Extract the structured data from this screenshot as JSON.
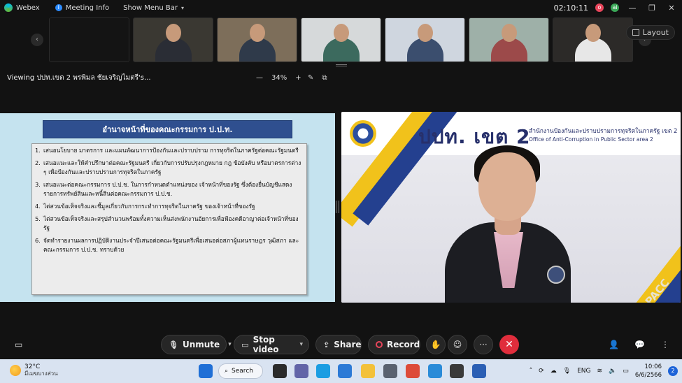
{
  "titlebar": {
    "app_name": "Webex",
    "meeting_info": "Meeting Info",
    "show_menu_bar": "Show Menu Bar",
    "timer": "02:10:11",
    "badge_o": "o",
    "badge_ai": "ai"
  },
  "strip": {
    "layout_label": "Layout",
    "thumbnails": [
      {
        "bg": "#141414",
        "shirt": "#1a1a1a"
      },
      {
        "bg": "#3a3832",
        "shirt": "#2a2d35"
      },
      {
        "bg": "#7d6e5a",
        "shirt": "#2f3a4a"
      },
      {
        "bg": "#d6d9da",
        "shirt": "#3c6a5e"
      },
      {
        "bg": "#cfd6df",
        "shirt": "#3b4e6e"
      },
      {
        "bg": "#9eb0a8",
        "shirt": "#9c4a4a"
      },
      {
        "bg": "#2c2a28",
        "shirt": "#e7e7e7"
      }
    ]
  },
  "viewbar": {
    "viewing_text": "Viewing ปปท.เขต 2 พรพิมล ชัยเจริญไมตรี's...",
    "zoom_level": "34%",
    "zoom_minus": "—",
    "zoom_plus": "+"
  },
  "slide": {
    "title": "อำนาจหน้าที่ของคณะกรรมการ ป.ป.ท.",
    "items": [
      {
        "num": "1.",
        "text": "เสนอนโยบาย มาตรการ และแผนพัฒนาการป้องกันและปราบปราม การทุจริตในภาครัฐต่อคณะรัฐมนตรี"
      },
      {
        "num": "2.",
        "text": "เสนอแนะและให้คำปรึกษาต่อคณะรัฐมนตรี เกี่ยวกับการปรับปรุงกฎหมาย กฎ ข้อบังคับ หรือมาตรการต่าง ๆ เพื่อป้องกันและปราบปรามการทุจริตในภาครัฐ"
      },
      {
        "num": "3.",
        "text": "เสนอแนะต่อคณะกรรมการ ป.ป.ช. ในการกำหนดตำแหน่งของ เจ้าหน้าที่ของรัฐ ซึ่งต้องยื่นบัญชีแสดงรายการทรัพย์สินและหนี้สินต่อคณะกรรมการ ป.ป.ช."
      },
      {
        "num": "4.",
        "text": "ไต่สวนข้อเท็จจริงและชี้มูลเกี่ยวกับการกระทำการทุจริตในภาครัฐ ของเจ้าหน้าที่ของรัฐ"
      },
      {
        "num": "5.",
        "text": "ไต่สวนข้อเท็จจริงและสรุปสำนวนพร้อมทั้งความเห็นส่งพนักงานอัยการเพื่อฟ้องคดีอาญาต่อเจ้าหน้าที่ของรัฐ"
      },
      {
        "num": "6.",
        "text": "จัดทำรายงานผลการปฏิบัติงานประจำปีเสนอต่อคณะรัฐมนตรีเพื่อเสนอต่อสภาผู้แทนราษฎร วุฒิสภา และคณะกรรมการ ป.ป.ช. ทราบด้วย"
      }
    ]
  },
  "video": {
    "org_short": "ปปท. เขต 2",
    "org_thai": "สำนักงานป้องกันและปราบปรามการทุจริตในภาครัฐ เขต 2",
    "org_english": "Office of Anti-Corruption in Public Sector area 2",
    "watermark": "PACC"
  },
  "controls": {
    "mute_label": "Unmute",
    "video_label": "Stop video",
    "share_label": "Share",
    "record_label": "Record",
    "end_icon": "✕",
    "more_icon": "···"
  },
  "taskbar": {
    "temperature": "32°C",
    "weather_desc": "มีเมฆบางส่วน",
    "search_label": "Search",
    "language": "ENG",
    "time": "10:06",
    "date": "6/6/2566",
    "notification_count": "2",
    "apps": [
      {
        "name": "windows",
        "color": "#1f6fd6"
      },
      {
        "name": "task-view",
        "color": "#2b2b2b"
      },
      {
        "name": "teams",
        "color": "#6264a7"
      },
      {
        "name": "edge",
        "color": "#1b9de2"
      },
      {
        "name": "store",
        "color": "#2c7ad6"
      },
      {
        "name": "file-explorer",
        "color": "#f3c13a"
      },
      {
        "name": "settings",
        "color": "#5a6270"
      },
      {
        "name": "chrome",
        "color": "#dd4b39"
      },
      {
        "name": "media",
        "color": "#2a8bd8"
      },
      {
        "name": "webex",
        "color": "#3a3a3a"
      },
      {
        "name": "word",
        "color": "#2b5fb4"
      }
    ]
  }
}
